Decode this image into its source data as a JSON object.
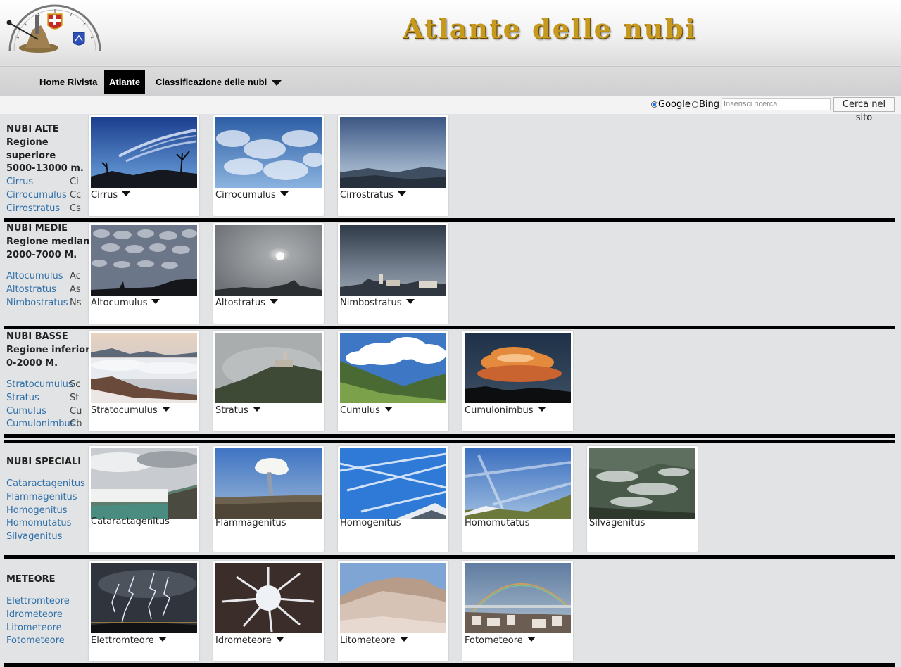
{
  "header": {
    "title": "Atlante delle nubi"
  },
  "nav": {
    "items": [
      {
        "label": "Home Rivista",
        "active": false
      },
      {
        "label": "Atlante",
        "active": true
      },
      {
        "label": "Classificazione delle nubi",
        "active": false,
        "dropdown": true
      }
    ]
  },
  "search": {
    "engines": [
      "Google",
      "Bing"
    ],
    "selected": "Google",
    "placeholder": "Inserisci ricerca",
    "button_label": "Cerca nel sito"
  },
  "sections": [
    {
      "id": "alte",
      "title_lines": [
        "NUBI ALTE",
        "Regione",
        "superiore",
        "5000-13000 m."
      ],
      "links": [
        {
          "name": "Cirrus",
          "abbr": "Ci"
        },
        {
          "name": "Cirrocumulus",
          "abbr": "Cc"
        },
        {
          "name": "Cirrostratus",
          "abbr": "Cs"
        }
      ],
      "cards": [
        {
          "label": "Cirrus",
          "dropdown": true,
          "photo": "cirrus"
        },
        {
          "label": "Cirrocumulus",
          "dropdown": true,
          "photo": "cirrocumulus"
        },
        {
          "label": "Cirrostratus",
          "dropdown": true,
          "photo": "cirrostratus"
        }
      ]
    },
    {
      "id": "medie",
      "title_lines": [
        "NUBI MEDIE",
        "Regione mediana",
        "2000-7000 M."
      ],
      "links": [
        {
          "name": "Altocumulus",
          "abbr": "Ac"
        },
        {
          "name": "Altostratus",
          "abbr": "As"
        },
        {
          "name": "Nimbostratus",
          "abbr": "Ns"
        }
      ],
      "cards": [
        {
          "label": "Altocumulus",
          "dropdown": true,
          "photo": "altocumulus"
        },
        {
          "label": "Altostratus",
          "dropdown": true,
          "photo": "altostratus"
        },
        {
          "label": "Nimbostratus",
          "dropdown": true,
          "photo": "nimbostratus"
        }
      ]
    },
    {
      "id": "basse",
      "title_lines": [
        "NUBI BASSE",
        "Regione inferiore",
        "0-2000 M."
      ],
      "links": [
        {
          "name": "Stratocumulus",
          "abbr": "Sc"
        },
        {
          "name": "Stratus",
          "abbr": "St"
        },
        {
          "name": "Cumulus",
          "abbr": "Cu"
        },
        {
          "name": "Cumulonimbus",
          "abbr": "Cb"
        }
      ],
      "cards": [
        {
          "label": "Stratocumulus",
          "dropdown": true,
          "photo": "stratocumulus"
        },
        {
          "label": "Stratus",
          "dropdown": true,
          "photo": "stratus"
        },
        {
          "label": "Cumulus",
          "dropdown": true,
          "photo": "cumulus"
        },
        {
          "label": "Cumulonimbus",
          "dropdown": true,
          "photo": "cumulonimbus"
        }
      ]
    },
    {
      "id": "speciali",
      "title_lines": [
        "NUBI SPECIALI"
      ],
      "links": [
        {
          "name": "Cataractagenitus",
          "abbr": ""
        },
        {
          "name": "Flammagenitus",
          "abbr": ""
        },
        {
          "name": "Homogenitus",
          "abbr": ""
        },
        {
          "name": "Homomutatus",
          "abbr": ""
        },
        {
          "name": "Silvagenitus",
          "abbr": ""
        }
      ],
      "cards": [
        {
          "label": "Cataractagenitus",
          "dropdown": false,
          "photo": "cataractagenitus"
        },
        {
          "label": "Flammagenitus",
          "dropdown": false,
          "photo": "flammagenitus"
        },
        {
          "label": "Homogenitus",
          "dropdown": false,
          "photo": "homogenitus"
        },
        {
          "label": "Homomutatus",
          "dropdown": false,
          "photo": "homomutatus"
        },
        {
          "label": "Silvagenitus",
          "dropdown": false,
          "photo": "silvagenitus"
        }
      ]
    },
    {
      "id": "meteore",
      "title_lines": [
        "METEORE"
      ],
      "links": [
        {
          "name": "Elettromteore",
          "abbr": ""
        },
        {
          "name": "Idrometeore",
          "abbr": ""
        },
        {
          "name": "Litometeore",
          "abbr": ""
        },
        {
          "name": "Fotometeore",
          "abbr": ""
        }
      ],
      "cards": [
        {
          "label": "Elettromteore",
          "dropdown": true,
          "photo": "elettrometeore"
        },
        {
          "label": "Idrometeore",
          "dropdown": true,
          "photo": "idrometeore"
        },
        {
          "label": "Litometeore",
          "dropdown": true,
          "photo": "litometeore"
        },
        {
          "label": "Fotometeore",
          "dropdown": true,
          "photo": "fotometeore"
        }
      ]
    }
  ]
}
